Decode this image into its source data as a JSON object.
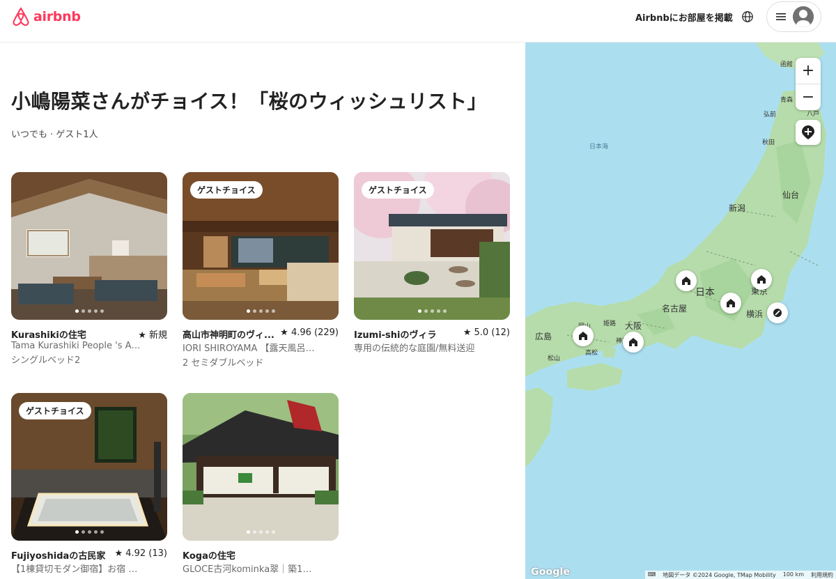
{
  "header": {
    "logo_text": "airbnb",
    "host_link": "Airbnbにお部屋を掲載",
    "brand_color": "#ff385c"
  },
  "main": {
    "title": "小嶋陽菜さんがチョイス！「桜のウィッシュリスト」",
    "subtitle": "いつでも · ゲスト1人"
  },
  "listings": [
    {
      "badge": "",
      "name": "Kurashikiの住宅",
      "rating": "★ 新規",
      "desc": "Tama Kurashiki People 's Art...",
      "beds": "シングルベッド2",
      "dots": 5,
      "active_dot": 0
    },
    {
      "badge": "ゲストチョイス",
      "name": "高山市神明町のヴィ...",
      "rating": "★ 4.96 (229)",
      "desc": "IORI SHIROYAMA 【露天風呂とサ...",
      "beds": "2 セミダブルベッド",
      "dots": 5,
      "active_dot": 0
    },
    {
      "badge": "ゲストチョイス",
      "name": "Izumi-shiのヴィラ",
      "rating": "★ 5.0 (12)",
      "desc": "専用の伝統的な庭園/無料送迎",
      "beds": "",
      "dots": 5,
      "active_dot": 0
    },
    {
      "badge": "ゲストチョイス",
      "name": "Fujiyoshidaの古民家",
      "rating": "★ 4.92 (13)",
      "desc": "【1棟貸切モダン御宿】お宿 櫻川...",
      "beds": "",
      "dots": 5,
      "active_dot": 0
    },
    {
      "badge": "",
      "name": "Kogaの住宅",
      "rating": "",
      "desc": "GLOCE古河kominka翠｜築150年...",
      "beds": "",
      "dots": 5,
      "active_dot": 0
    }
  ],
  "map": {
    "zoom_in": "+",
    "zoom_out": "−",
    "cities": {
      "hakodate": "函館",
      "aomori": "青森",
      "hirosaki": "弘前",
      "hachinohe": "八戸",
      "akita": "秋田",
      "sendai": "仙台",
      "niigata": "新潟",
      "nihon": "日本",
      "nagoya": "名古屋",
      "tokyo": "東京",
      "yokohama": "横浜",
      "osaka": "大阪",
      "kobe": "神戸",
      "himeji": "姫路",
      "okayama": "岡山",
      "hiroshima": "広島",
      "takamatsu": "高松",
      "matsuyama": "松山",
      "sea_of_japan": "日本海"
    },
    "google": "Google",
    "attribution": "地図データ ©2024 Google, TMap Mobility",
    "scale": "100 km",
    "terms": "利用規約"
  }
}
